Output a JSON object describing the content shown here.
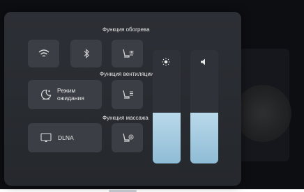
{
  "labels": {
    "heating": "Функция обогрева",
    "ventilation": "Функция вентиляции",
    "massage": "Функция массажа"
  },
  "tiles": {
    "standby_label": "Режим ожидания",
    "dlna_label": "DLNA"
  },
  "sliders": {
    "brightness": {
      "icon": "sun-icon",
      "level": 0.45
    },
    "volume": {
      "icon": "speaker-icon",
      "level": 0.45
    }
  },
  "colors": {
    "panel": "#2c2f35",
    "tile": "#3b3e44",
    "slider_fill": "#a9cde2"
  }
}
